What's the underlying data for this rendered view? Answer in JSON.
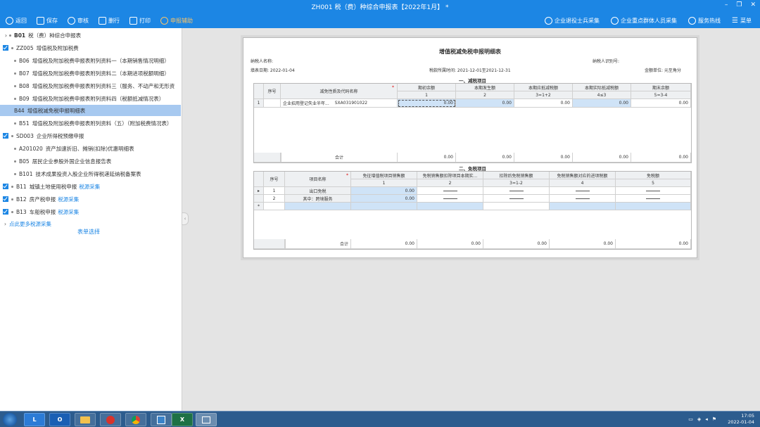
{
  "window": {
    "title": "ZH001 税（费）种综合申报表【2022年1月】 *"
  },
  "toolbar": {
    "back": "返回",
    "save": "保存",
    "review": "审核",
    "clear": "删行",
    "print": "打印",
    "assist": "申报辅助",
    "collect1": "企业退役士兵采集",
    "collect2": "企业重点群体人员采集",
    "hotline": "服务热线",
    "menu": "菜单"
  },
  "sidebar": {
    "items": [
      {
        "code": "B01",
        "label": "税（费）种综合申报表"
      },
      {
        "code": "ZZ005",
        "label": "增值税及附加税费"
      },
      {
        "code": "B06",
        "label": "增值税及附加税费申报表附列资料一（本期销售情况明细）"
      },
      {
        "code": "B07",
        "label": "增值税及附加税费申报表附列资料二（本期进项税额明细）"
      },
      {
        "code": "B08",
        "label": "增值税及附加税费申报表附列资料三（服务、不动产和无形资"
      },
      {
        "code": "B09",
        "label": "增值税及附加税费申报表附列资料四（税额抵减情况表）"
      },
      {
        "code": "B44",
        "label": "增值税减免税申报明细表"
      },
      {
        "code": "B51",
        "label": "增值税及附加税费申报表附列资料（五）（附加税费情况表）"
      },
      {
        "code": "SD003",
        "label": "企业所得税预缴申报"
      },
      {
        "code": "A201020",
        "label": "资产加速折旧、摊销(扣除)优惠明细表"
      },
      {
        "code": "B05",
        "label": "居民企业参股外国企业信息报告表"
      },
      {
        "code": "B101",
        "label": "技术成果投资入股企业所得税递延纳税备案表"
      },
      {
        "code": "B11",
        "label": "城镇土地使用税申报",
        "link": "税源采集"
      },
      {
        "code": "B12",
        "label": "房产税申报",
        "link": "税源采集"
      },
      {
        "code": "B13",
        "label": "车船税申报",
        "link": "税源采集"
      }
    ],
    "more_link": "点此更多税源采集",
    "form_select": "表单选择"
  },
  "doc": {
    "title": "增值税减免税申报明细表",
    "taxpayer_name_label": "纳税人名称:",
    "taxpayer_id_label": "纳税人识别号:",
    "fill_date": "填表日期: 2022-01-04",
    "period": "税款所属时间: 2021-12-01至2021-12-31",
    "unit": "金额单位: 元至角分",
    "sec1": {
      "title": "一、减税项目",
      "h_seq": "序号",
      "h_name": "减免性质及代码名称",
      "cols": [
        {
          "name": "期初余额",
          "idx": "1"
        },
        {
          "name": "本期发生额",
          "idx": "2"
        },
        {
          "name": "本期应抵减税额",
          "idx": "3=1+2"
        },
        {
          "name": "本期实际抵减税额",
          "idx": "4≤3"
        },
        {
          "name": "期末余额",
          "idx": "5=3-4"
        }
      ],
      "row": {
        "seq": "1",
        "name": "企业招用登记失业半年...",
        "code": "SXA031901022",
        "v": [
          "0.00",
          "0.00",
          "0.00",
          "0.00",
          "0.00"
        ]
      },
      "total_label": "合计",
      "total": [
        "0.00",
        "0.00",
        "0.00",
        "0.00",
        "0.00"
      ]
    },
    "sec2": {
      "title": "二、免税项目",
      "h_seq": "序号",
      "h_name": "项目名称",
      "cols": [
        {
          "name": "免征增值税项目销售额",
          "idx": "1"
        },
        {
          "name": "免税销售额扣除项目本期实...",
          "idx": "2"
        },
        {
          "name": "扣除后免税销售额",
          "idx": "3=1-2"
        },
        {
          "name": "免税销售额对应的进项税额",
          "idx": "4"
        },
        {
          "name": "免税额",
          "idx": "5"
        }
      ],
      "rows": [
        {
          "marker": "▸",
          "seq": "1",
          "name": "出口免税",
          "v1": "0.00"
        },
        {
          "marker": "",
          "seq": "2",
          "name": "其中：跨境服务",
          "v1": "0.00"
        }
      ],
      "new_marker": "*",
      "total_label": "合计",
      "total": [
        "0.00",
        "0.00",
        "0.00",
        "0.00",
        "0.00"
      ]
    }
  },
  "taskbar": {
    "apps": [
      "L",
      "O",
      "",
      "",
      "",
      "",
      "X",
      ""
    ],
    "time": "17:05",
    "date": "2022-01-04"
  },
  "colors": {
    "accent": "#1c86e4",
    "selected": "#a7c9f0",
    "editable": "#cfe3f7"
  }
}
